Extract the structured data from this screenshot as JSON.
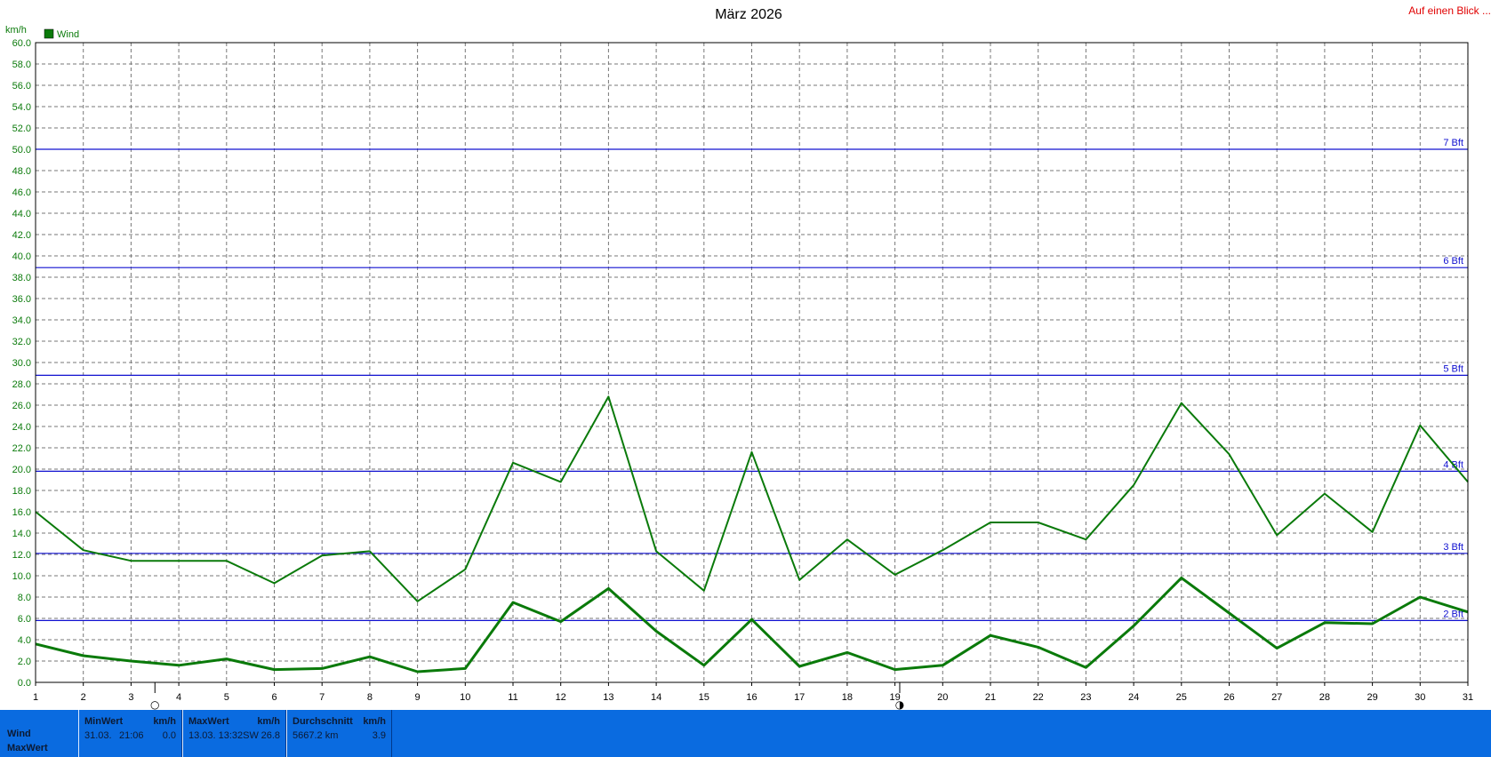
{
  "header": {
    "link_label": "Auf einen Blick ..."
  },
  "chart_data": {
    "type": "line",
    "title": "März 2026",
    "ylabel": "km/h",
    "xlabel": "",
    "ylim": [
      0,
      60
    ],
    "y_tick_step": 2,
    "xlim": [
      1,
      31
    ],
    "x_ticks": [
      1,
      2,
      3,
      4,
      5,
      6,
      7,
      8,
      9,
      10,
      11,
      12,
      13,
      14,
      15,
      16,
      17,
      18,
      19,
      20,
      21,
      22,
      23,
      24,
      25,
      26,
      27,
      28,
      29,
      30,
      31
    ],
    "grid": true,
    "legend": {
      "position": "top-left",
      "entries": [
        "Wind"
      ]
    },
    "colors": {
      "series": "#0a7a0a",
      "beaufort": "#1010d0",
      "grid": "#777777",
      "axis": "#000000"
    },
    "series": [
      {
        "name": "Wind",
        "values": [
          3.6,
          2.5,
          2.0,
          1.6,
          2.2,
          1.2,
          1.3,
          2.4,
          1.0,
          1.3,
          7.5,
          5.7,
          8.8,
          4.8,
          1.6,
          5.9,
          1.5,
          2.8,
          1.2,
          1.6,
          4.4,
          3.3,
          1.4,
          5.3,
          9.8,
          6.5,
          3.2,
          5.6,
          5.5,
          8.0,
          6.6
        ]
      },
      {
        "values": [
          16.0,
          12.4,
          11.4,
          11.4,
          11.4,
          9.3,
          11.9,
          12.3,
          7.6,
          10.6,
          20.6,
          18.8,
          26.8,
          12.3,
          8.6,
          21.6,
          9.6,
          13.4,
          10.1,
          12.4,
          15.0,
          15.0,
          13.4,
          18.5,
          26.2,
          21.4,
          13.8,
          17.7,
          14.1,
          24.1,
          18.8
        ]
      }
    ],
    "beaufort_lines": [
      {
        "label": "2 Bft",
        "value": 5.8
      },
      {
        "label": "3 Bft",
        "value": 12.1
      },
      {
        "label": "4 Bft",
        "value": 19.8
      },
      {
        "label": "5 Bft",
        "value": 28.8
      },
      {
        "label": "6 Bft",
        "value": 38.9
      },
      {
        "label": "7 Bft",
        "value": 50.0
      }
    ],
    "moon_markers": [
      {
        "x": 3.5,
        "symbol": "○"
      },
      {
        "x": 19.1,
        "symbol": "◑"
      }
    ]
  },
  "panel": {
    "row_labels": [
      "Wind",
      "MaxWert"
    ],
    "min": {
      "header": "MinWert",
      "unit": "km/h",
      "date": "31.03.",
      "time": "21:06",
      "value": "0.0"
    },
    "max": {
      "header": "MaxWert",
      "unit": "km/h",
      "datetime": "13.03.  13:32SW",
      "value": "26.8"
    },
    "avg": {
      "header": "Durchschnitt",
      "unit": "km/h",
      "distance": "5667.2 km",
      "value": "3.9"
    }
  }
}
